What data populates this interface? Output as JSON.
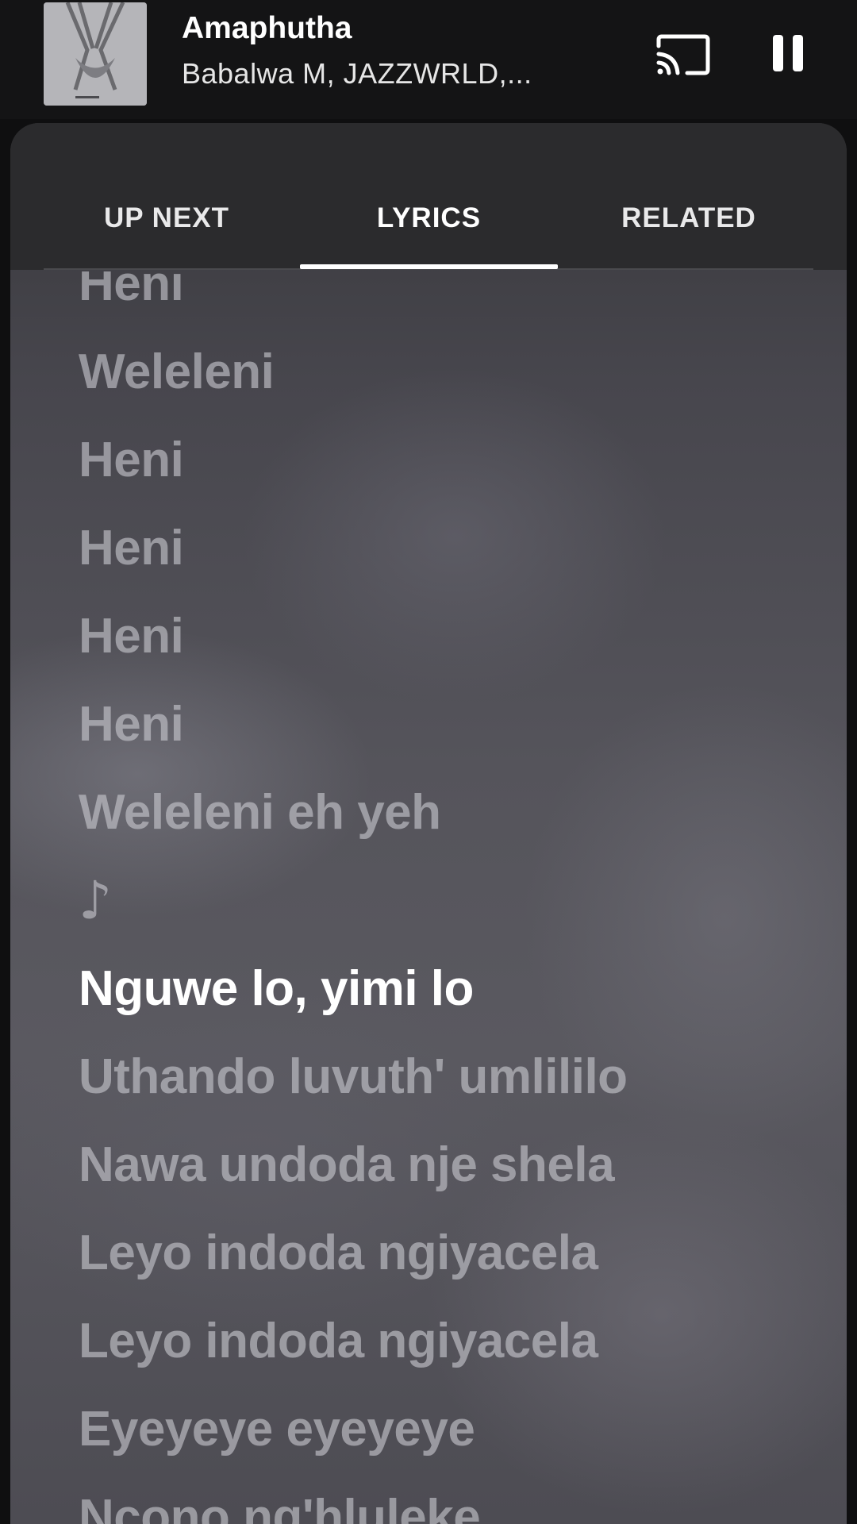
{
  "now_playing": {
    "title": "Amaphutha",
    "artist": "Babalwa M, JAZZWRLD,...",
    "cast_icon": "cast-icon",
    "pause_icon": "pause-icon"
  },
  "tabs": [
    {
      "label": "UP NEXT",
      "selected": false
    },
    {
      "label": "LYRICS",
      "selected": true
    },
    {
      "label": "RELATED",
      "selected": false
    }
  ],
  "lyrics": [
    {
      "text": "Heni",
      "active": false
    },
    {
      "text": "Weleleni",
      "active": false
    },
    {
      "text": "Heni",
      "active": false
    },
    {
      "text": "Heni",
      "active": false
    },
    {
      "text": "Heni",
      "active": false
    },
    {
      "text": "Heni",
      "active": false
    },
    {
      "text": "Weleleni eh yeh",
      "active": false
    },
    {
      "text": "♪",
      "active": false
    },
    {
      "text": "Nguwe lo, yimi lo",
      "active": true
    },
    {
      "text": "Uthando luvuth' umlililo",
      "active": false
    },
    {
      "text": "Nawa undoda nje shela",
      "active": false
    },
    {
      "text": "Leyo indoda ngiyacela",
      "active": false
    },
    {
      "text": "Leyo indoda ngiyacela",
      "active": false
    },
    {
      "text": "Eyeyeye eyeyeye",
      "active": false
    },
    {
      "text": "Ncono ng'hluleke",
      "active": false
    }
  ],
  "colors": {
    "active_lyric": "#ffffff",
    "inactive_lyric": "#c8c8ce",
    "background": "#0f0f10"
  }
}
